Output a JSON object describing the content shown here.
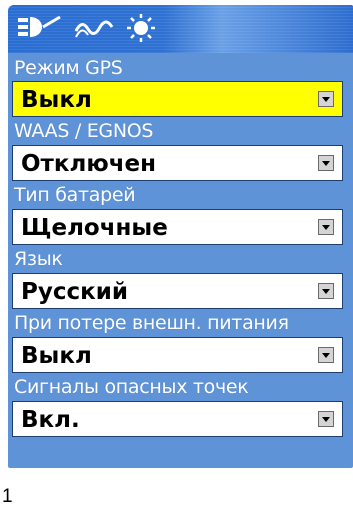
{
  "settings": [
    {
      "label": "Режим GPS",
      "value": "Выкл"
    },
    {
      "label": "WAAS / EGNOS",
      "value": "Отключен"
    },
    {
      "label": "Тип батарей",
      "value": "Щелочные"
    },
    {
      "label": "Язык",
      "value": "Русский"
    },
    {
      "label": "При потере внешн. питания",
      "value": "Выкл"
    },
    {
      "label": "Сигналы опасных точек",
      "value": "Вкл."
    }
  ],
  "header": {
    "icons": [
      "satellite-icon",
      "signal-wave-icon",
      "backlight-sun-icon"
    ]
  },
  "colors": {
    "background_panel": "#5f93d7",
    "header_blue": "#2a6ed2",
    "selected_field": "#ffff00"
  },
  "footnote": "1"
}
